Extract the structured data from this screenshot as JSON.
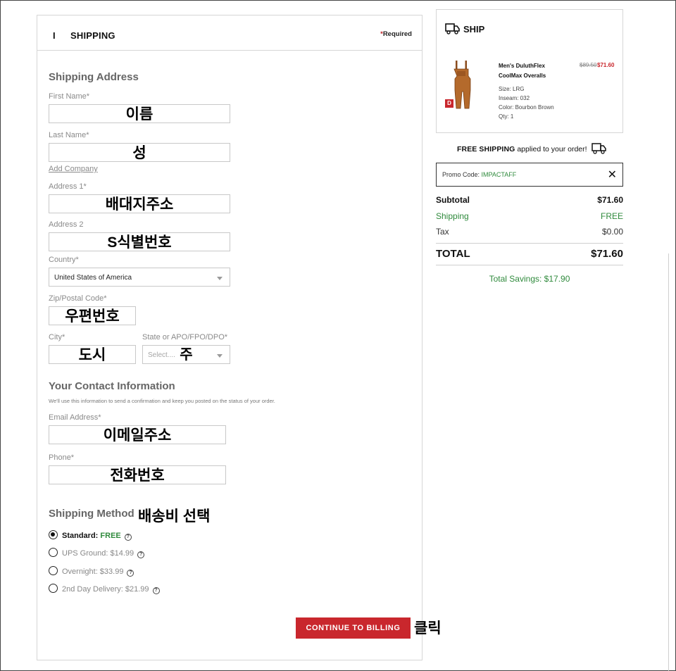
{
  "header": {
    "step_marker": "I",
    "title": "SHIPPING",
    "required_star": "*",
    "required_label": "Required"
  },
  "address": {
    "title": "Shipping Address",
    "first_name_label": "First Name*",
    "first_name_value": "이름",
    "last_name_label": "Last Name*",
    "last_name_value": "성",
    "add_company": "Add Company",
    "address1_label": "Address 1*",
    "address1_value": "배대지주소",
    "address2_label": "Address 2",
    "address2_value": "S식별번호",
    "country_label": "Country*",
    "country_value": "United States of America",
    "zip_label": "Zip/Postal Code*",
    "zip_value": "우편번호",
    "city_label": "City*",
    "city_value": "도시",
    "state_label": "State or APO/FPO/DPO*",
    "state_placeholder": "Select....",
    "state_value": "주"
  },
  "contact": {
    "title": "Your Contact Information",
    "note": "We'll use this information to send a confirmation and keep you posted on the status of your order.",
    "email_label": "Email Address*",
    "email_value": "이메일주소",
    "phone_label": "Phone*",
    "phone_value": "전화번호"
  },
  "shipping_method": {
    "title": "Shipping Method",
    "annotation": "배송비 선택",
    "options": [
      {
        "label": "Standard:",
        "price": "FREE",
        "selected": true
      },
      {
        "label": "UPS Ground: $14.99",
        "price": "",
        "selected": false
      },
      {
        "label": "Overnight: $33.99",
        "price": "",
        "selected": false
      },
      {
        "label": "2nd Day Delivery: $21.99",
        "price": "",
        "selected": false
      }
    ],
    "help_glyph": "?"
  },
  "cta": {
    "label": "CONTINUE TO BILLING",
    "annotation": "클릭"
  },
  "cart": {
    "title": "SHIP",
    "badge": "D",
    "product": {
      "name_line1": "Men's DuluthFlex",
      "name_line2": "CoolMax Overalls",
      "size": "Size: LRG",
      "inseam": "Inseam: 032",
      "color": "Color: Bourbon Brown",
      "qty": "Qty: 1",
      "old_price": "$89.50",
      "new_price": "$71.60"
    }
  },
  "free_shipping": {
    "bold": "FREE SHIPPING",
    "rest": "applied to your order!"
  },
  "promo": {
    "label": "Promo Code:",
    "code": "IMPACTAFF",
    "remove": "✕"
  },
  "summary": {
    "subtotal_label": "Subtotal",
    "subtotal_value": "$71.60",
    "shipping_label": "Shipping",
    "shipping_value": "FREE",
    "tax_label": "Tax",
    "tax_value": "$0.00",
    "total_label": "TOTAL",
    "total_value": "$71.60",
    "savings": "Total Savings: $17.90"
  },
  "colors": {
    "accent_red": "#c9272d",
    "success_green": "#2f8a3c"
  }
}
